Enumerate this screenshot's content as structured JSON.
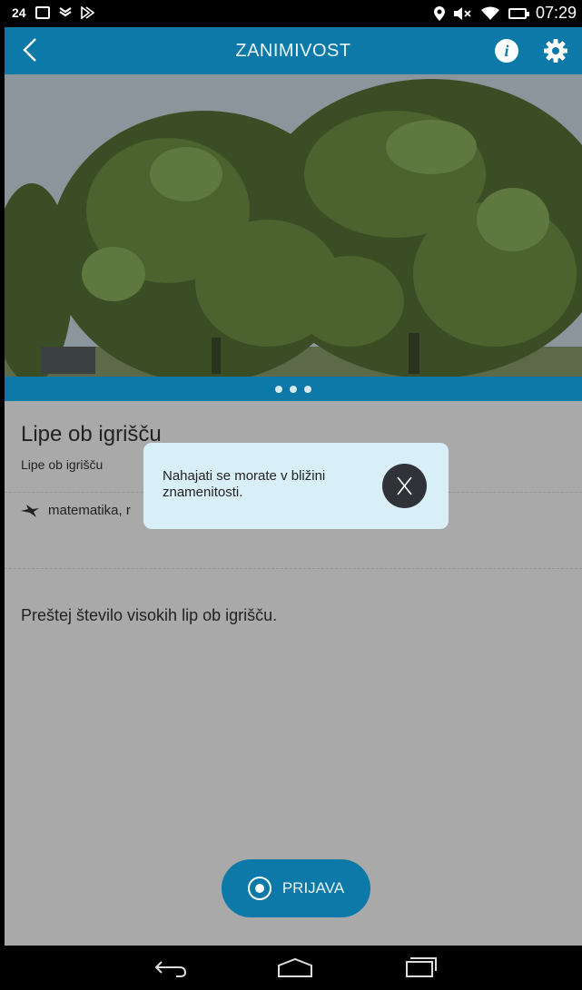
{
  "status_bar": {
    "left_label": "24",
    "time": "07:29",
    "icons": [
      "image-icon",
      "mail-icon",
      "play-icon",
      "location-icon",
      "volume-muted-icon",
      "wifi-icon",
      "battery-icon"
    ]
  },
  "app_bar": {
    "title": "ZANIMIVOST",
    "icons": [
      "back-icon",
      "info-icon",
      "settings-icon"
    ]
  },
  "gallery": {
    "dot_count": 3
  },
  "detail": {
    "title": "Lipe ob igrišču",
    "subtitle": "Lipe ob igrišču",
    "tags": "matematika, r",
    "description": "Preštej število visokih lip ob igrišču."
  },
  "action": {
    "label": "PRIJAVA"
  },
  "popup": {
    "message": "Nahajati se morate v bližini znamenitosti."
  },
  "colors": {
    "accent": "#0d79a9",
    "popup_bg": "#d9eff8",
    "overlay_bg": "#a9a9a9"
  }
}
